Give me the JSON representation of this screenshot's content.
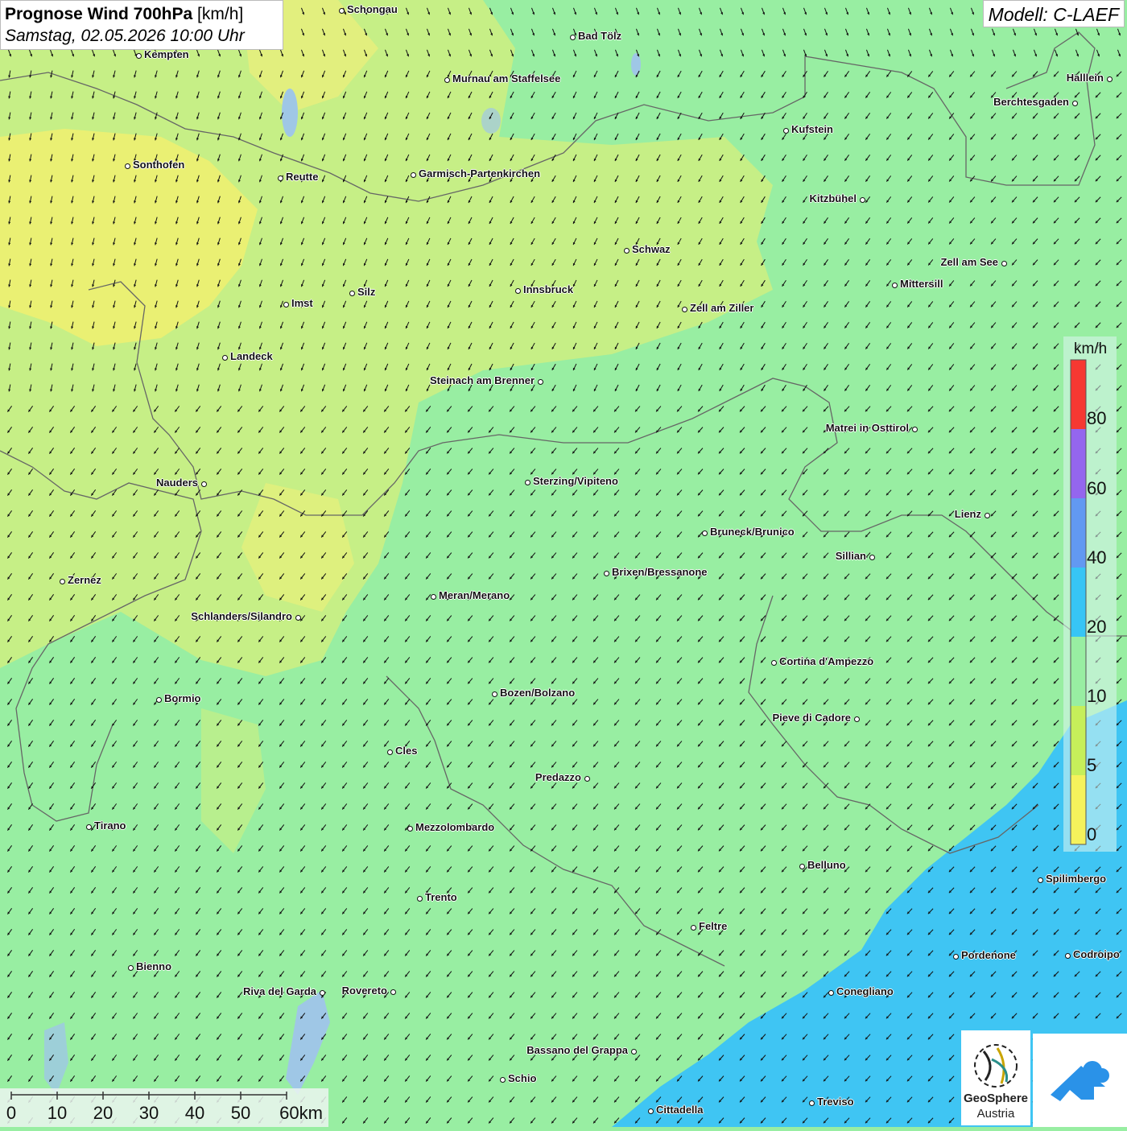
{
  "header": {
    "title_bold": "Prognose Wind 700hPa",
    "title_unit": " [km/h]",
    "datetime": "Samstag, 02.05.2026 10:00 Uhr",
    "model": "Modell: C-LAEF"
  },
  "legend": {
    "unit": "km/h",
    "ticks": [
      "80",
      "60",
      "40",
      "20",
      "10",
      "5",
      "0"
    ],
    "colors": [
      "#f63832",
      "#9466ee",
      "#6299f2",
      "#37c5f5",
      "#98eea2",
      "#c6ef5a",
      "#f5f25c"
    ]
  },
  "scalebar": {
    "labels": [
      "0",
      "10",
      "20",
      "30",
      "40",
      "50",
      "60km"
    ]
  },
  "logo": {
    "org_line1": "GeoSphere",
    "org_line2": "Austria"
  },
  "cities": [
    {
      "name": "Schongau"
    },
    {
      "name": "Bad Tölz"
    },
    {
      "name": "Kempten"
    },
    {
      "name": "Murnau am Staffelsee"
    },
    {
      "name": "Halllein"
    },
    {
      "name": "Berchtesgaden"
    },
    {
      "name": "Kufstein"
    },
    {
      "name": "Sonthofen"
    },
    {
      "name": "Reutte"
    },
    {
      "name": "Garmisch-Partenkirchen"
    },
    {
      "name": "Kitzbühel"
    },
    {
      "name": "Schwaz"
    },
    {
      "name": "Zell am See"
    },
    {
      "name": "Mittersill"
    },
    {
      "name": "Silz"
    },
    {
      "name": "Innsbruck"
    },
    {
      "name": "Imst"
    },
    {
      "name": "Zell am Ziller"
    },
    {
      "name": "Landeck"
    },
    {
      "name": "Steinach am Brenner"
    },
    {
      "name": "Matrei in Osttirol"
    },
    {
      "name": "Nauders"
    },
    {
      "name": "Sterzing/Vipiteno"
    },
    {
      "name": "Lienz"
    },
    {
      "name": "Bruneck/Brunico"
    },
    {
      "name": "Sillian"
    },
    {
      "name": "Brixen/Bressanone"
    },
    {
      "name": "Zernez"
    },
    {
      "name": "Meran/Merano"
    },
    {
      "name": "Schlanders/Silandro"
    },
    {
      "name": "Cortina d'Ampezzo"
    },
    {
      "name": "Bozen/Bolzano"
    },
    {
      "name": "Bormio"
    },
    {
      "name": "Pieve di Cadore"
    },
    {
      "name": "Cles"
    },
    {
      "name": "Predazzo"
    },
    {
      "name": "Tirano"
    },
    {
      "name": "Mezzolombardo"
    },
    {
      "name": "Belluno"
    },
    {
      "name": "Spilimbergo"
    },
    {
      "name": "Trento"
    },
    {
      "name": "Feltre"
    },
    {
      "name": "Pordenone"
    },
    {
      "name": "Codroipo"
    },
    {
      "name": "Bienno"
    },
    {
      "name": "Riva del Garda"
    },
    {
      "name": "Rovereto"
    },
    {
      "name": "Conegliano"
    },
    {
      "name": "Bassano del Grappa"
    },
    {
      "name": "Schio"
    },
    {
      "name": "Treviso"
    },
    {
      "name": "Cittadella"
    }
  ]
}
